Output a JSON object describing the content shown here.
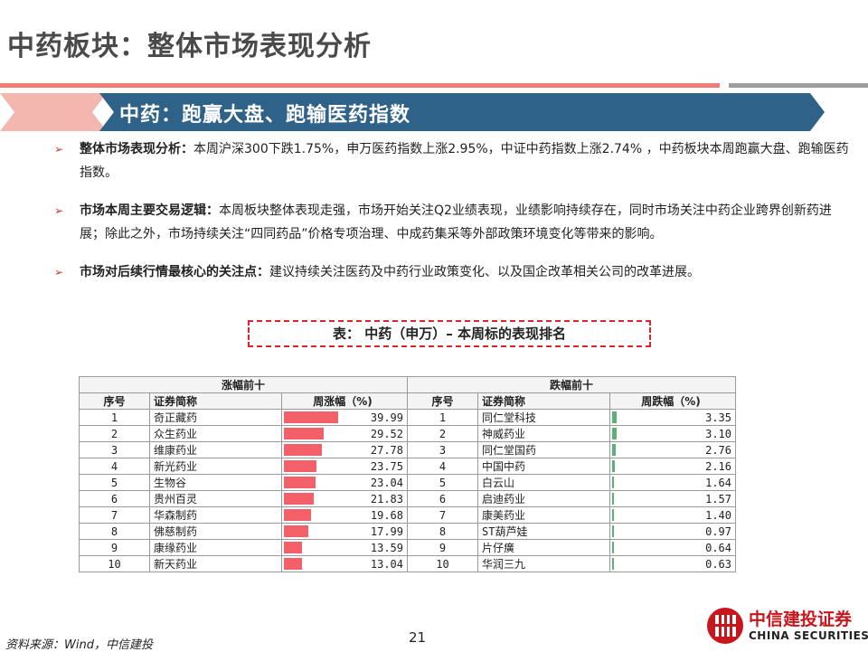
{
  "title": "中药板块：整体市场表现分析",
  "banner": "中药：跑赢大盘、跑输医药指数",
  "bullets": [
    {
      "head": "整体市场表现分析：",
      "text": "本周沪深300下跌1.75%，申万医药指数上涨2.95%，中证中药指数上涨2.74% ，中药板块本周跑赢大盘、跑输医药指数。"
    },
    {
      "head": "市场本周主要交易逻辑：",
      "text": "本周板块整体表现走强，市场开始关注Q2业绩表现，业绩影响持续存在，同时市场关注中药企业跨界创新药进展；除此之外，市场持续关注“四同药品”价格专项治理、中成药集采等外部政策环境变化等带来的影响。"
    },
    {
      "head": "市场对后续行情最核心的关注点：",
      "text": "建议持续关注医药及中药行业政策变化、以及国企改革相关公司的改革进展。"
    }
  ],
  "table_caption": "表： 中药（申万）– 本周标的表现排名",
  "table": {
    "left_title": "涨幅前十",
    "right_title": "跌幅前十",
    "left_headers": [
      "序号",
      "证券简称",
      "周涨幅（%)"
    ],
    "right_headers": [
      "序号",
      "证券简称",
      "周跌幅（%)"
    ],
    "gainers": [
      {
        "rank": "1",
        "name": "奇正藏药",
        "value": "39.99",
        "v": 39.99
      },
      {
        "rank": "2",
        "name": "众生药业",
        "value": "29.52",
        "v": 29.52
      },
      {
        "rank": "3",
        "name": "维康药业",
        "value": "27.78",
        "v": 27.78
      },
      {
        "rank": "4",
        "name": "新光药业",
        "value": "23.75",
        "v": 23.75
      },
      {
        "rank": "5",
        "name": "生物谷",
        "value": "23.04",
        "v": 23.04
      },
      {
        "rank": "6",
        "name": "贵州百灵",
        "value": "21.83",
        "v": 21.83
      },
      {
        "rank": "7",
        "name": "华森制药",
        "value": "19.68",
        "v": 19.68
      },
      {
        "rank": "8",
        "name": "佛慈制药",
        "value": "17.99",
        "v": 17.99
      },
      {
        "rank": "9",
        "name": "康缘药业",
        "value": "13.59",
        "v": 13.59
      },
      {
        "rank": "10",
        "name": "新天药业",
        "value": "13.04",
        "v": 13.04
      }
    ],
    "losers": [
      {
        "rank": "1",
        "name": "同仁堂科技",
        "value": "3.35",
        "v": 3.35
      },
      {
        "rank": "2",
        "name": "神威药业",
        "value": "3.10",
        "v": 3.1
      },
      {
        "rank": "3",
        "name": "同仁堂国药",
        "value": "2.76",
        "v": 2.76
      },
      {
        "rank": "4",
        "name": "中国中药",
        "value": "2.16",
        "v": 2.16
      },
      {
        "rank": "5",
        "name": "白云山",
        "value": "1.64",
        "v": 1.64
      },
      {
        "rank": "6",
        "name": "启迪药业",
        "value": "1.57",
        "v": 1.57
      },
      {
        "rank": "7",
        "name": "康美药业",
        "value": "1.40",
        "v": 1.4
      },
      {
        "rank": "8",
        "name": "ST葫芦娃",
        "value": "0.97",
        "v": 0.97
      },
      {
        "rank": "9",
        "name": "片仔癀",
        "value": "0.64",
        "v": 0.64
      },
      {
        "rank": "10",
        "name": "华润三九",
        "value": "0.63",
        "v": 0.63
      }
    ],
    "gain_bar_color": "#f4606a",
    "loss_bar_color": "#5cb078"
  },
  "source": "资料来源：Wind，中信建投",
  "page_number": "21",
  "logo": {
    "cn": "中信建投证券",
    "en": "CHINA SECURITIES"
  },
  "colors": {
    "banner": "#2f6289",
    "accent_red": "#ee7d73",
    "title": "#4a4a4a"
  }
}
